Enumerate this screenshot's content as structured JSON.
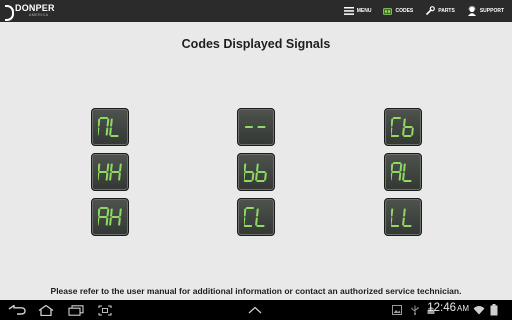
{
  "app": {
    "logo_name": "DONPER",
    "logo_sub": "AMERICA"
  },
  "nav": [
    {
      "label": "MENU",
      "icon": "hamburger-icon"
    },
    {
      "label": "CODES",
      "icon": "codes-icon"
    },
    {
      "label": "PARTS",
      "icon": "wrench-icon"
    },
    {
      "label": "SUPPORT",
      "icon": "support-icon"
    }
  ],
  "title": "Codes Displayed Signals",
  "codes": [
    {
      "label": "NL"
    },
    {
      "label": "--"
    },
    {
      "label": "Cb"
    },
    {
      "label": "HH"
    },
    {
      "label": "bb"
    },
    {
      "label": "AL"
    },
    {
      "label": "AH"
    },
    {
      "label": "CL"
    },
    {
      "label": "LL"
    }
  ],
  "footer_note": "Please refer to the user manual for additional information or contact an authorized service technician.",
  "system_bar": {
    "time": "12:46",
    "ampm": "AM",
    "buttons": [
      "back-icon",
      "home-icon",
      "recent-apps-icon",
      "screenshot-icon",
      "chevron-up-icon",
      "gallery-icon",
      "usb-icon",
      "android-icon",
      "wifi-icon",
      "battery-icon"
    ]
  },
  "colors": {
    "segment": "#8fdb62",
    "tile": "#3f433f",
    "topbar": "#2b2b2b"
  }
}
